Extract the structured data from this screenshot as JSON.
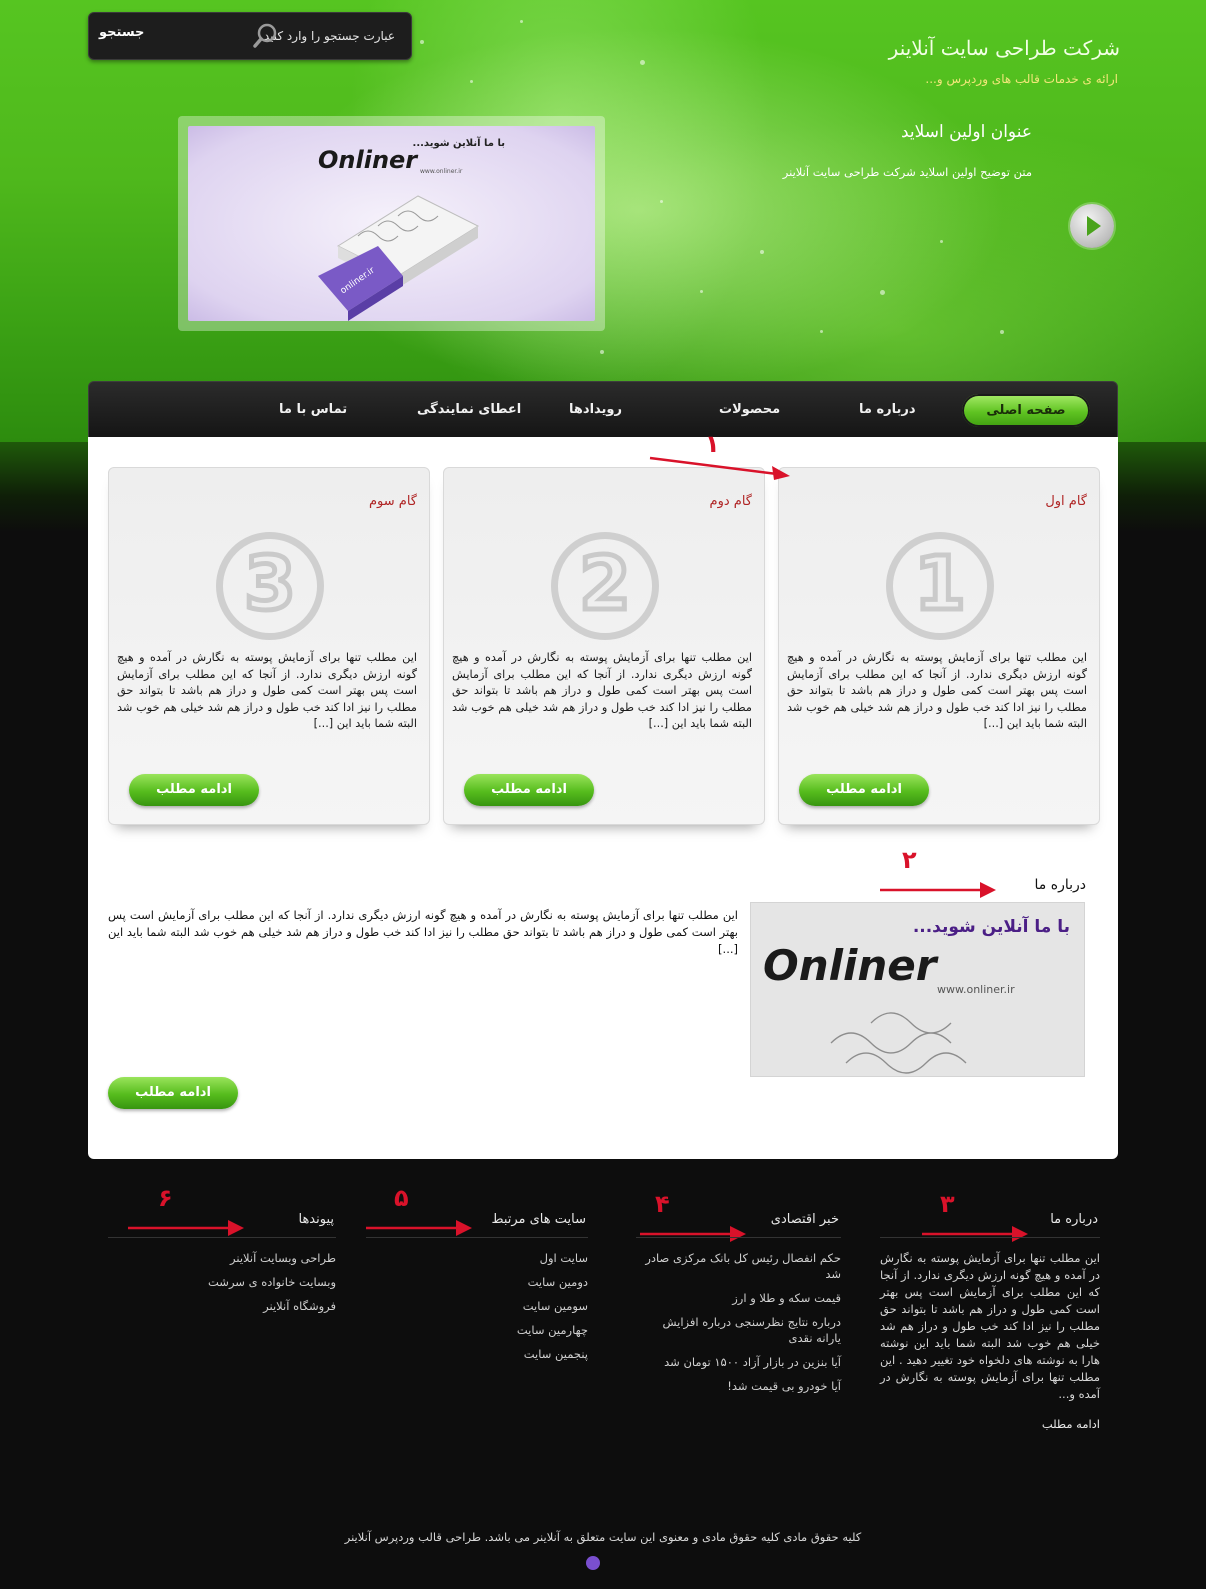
{
  "header": {
    "site_title": "شرکت طراحی سایت آنلاینر",
    "site_subtitle": "ارائه ی خدمات قالب های وردپرس و...",
    "search": {
      "placeholder": "عبارت جستجو را وارد کنید",
      "button_label": "جستجو"
    },
    "slider": {
      "title": "عنوان اولین اسلاید",
      "description": "متن توضیح اولین اسلاید شرکت طراحی سایت آنلاینر",
      "image_caption": "با ما آنلاین شوید...",
      "image_logo": "Onliner",
      "image_url": "www.onliner.ir",
      "image_piece_text": "onliner.ir"
    }
  },
  "nav": {
    "items": [
      {
        "label": "صفحه اصلی",
        "active": true
      },
      {
        "label": "درباره ما"
      },
      {
        "label": "محصولات"
      },
      {
        "label": "رویدادها"
      },
      {
        "label": "اعطای نمایندگی"
      },
      {
        "label": "تماس با ما"
      }
    ]
  },
  "steps": [
    {
      "title": "گام اول",
      "number": "1",
      "text": "این مطلب تنها برای آزمایش پوسته به نگارش در آمده و هیچ گونه ارزش دیگری ندارد. از آنجا که این مطلب برای آزمایش است پس بهتر است کمی طول و دراز هم باشد تا بتواند حق مطلب را نیز ادا کند خب طول و دراز هم شد خیلی هم خوب شد البته شما باید این [...]",
      "button": "ادامه مطلب"
    },
    {
      "title": "گام دوم",
      "number": "2",
      "text": "این مطلب تنها برای آزمایش پوسته به نگارش در آمده و هیچ گونه ارزش دیگری ندارد. از آنجا که این مطلب برای آزمایش است پس بهتر است کمی طول و دراز هم باشد تا بتواند حق مطلب را نیز ادا کند خب طول و دراز هم شد خیلی هم خوب شد البته شما باید این [...]",
      "button": "ادامه مطلب"
    },
    {
      "title": "گام سوم",
      "number": "3",
      "text": "این مطلب تنها برای آزمایش پوسته به نگارش در آمده و هیچ گونه ارزش دیگری ندارد. از آنجا که این مطلب برای آزمایش است پس بهتر است کمی طول و دراز هم باشد تا بتواند حق مطلب را نیز ادا کند خب طول و دراز هم شد خیلی هم خوب شد البته شما باید این [...]",
      "button": "ادامه مطلب"
    }
  ],
  "about": {
    "title": "درباره ما",
    "text": "این مطلب تنها برای آزمایش پوسته به نگارش در آمده و هیچ گونه ارزش دیگری ندارد. از آنجا که این مطلب برای آزمایش است پس بهتر است کمی طول و دراز هم باشد تا بتواند حق مطلب را نیز ادا کند خب طول و دراز هم شد خیلی هم خوب شد البته شما باید این [...]",
    "button": "ادامه مطلب",
    "image_caption": "با ما آنلاین شوید...",
    "image_logo": "Onliner",
    "image_url": "www.onliner.ir"
  },
  "annotations": [
    "۱",
    "۲",
    "۳",
    "۴",
    "۵",
    "۶"
  ],
  "footer": {
    "about": {
      "title": "درباره ما",
      "text": "این مطلب تنها برای آزمایش پوسته به نگارش در آمده و هیچ گونه ارزش دیگری ندارد. از آنجا که این مطلب برای آزمایش است پس بهتر است کمی طول و دراز هم باشد تا بتواند حق مطلب را نیز ادا کند خب طول و دراز هم شد خیلی هم خوب شد البته شما باید این نوشته هارا به نوشته های دلخواه خود تغییر دهید . این مطلب تنها برای آزمایش پوسته به نگارش در آمده و...",
      "more": "ادامه مطلب"
    },
    "news": {
      "title": "خبر اقتصادی",
      "items": [
        "حکم انفصال رئیس کل بانک مرکزی صادر شد",
        "قیمت سکه و طلا و ارز",
        "درباره نتایج نظرسنجی درباره افزایش یارانه نقدی",
        "آیا بنزین در بازار آزاد ۱۵۰۰ تومان شد",
        "آیا خودرو بی قیمت شد!"
      ]
    },
    "related": {
      "title": "سایت های مرتبط",
      "items": [
        "سایت اول",
        "دومین سایت",
        "سومین سایت",
        "چهارمین سایت",
        "پنجمین سایت"
      ]
    },
    "links": {
      "title": "پیوندها",
      "items": [
        "طراحی وبسایت آنلاینر",
        "وبسایت خانواده ی سرشت",
        "فروشگاه آنلاینر"
      ]
    },
    "copyright": "کلیه حقوق مادی کلیه حقوق مادی و معنوی این سایت متعلق به آنلاینر می باشد. طراحی قالب وردپرس آنلاینر"
  },
  "colors": {
    "header_green": "#4fb81c",
    "button_green": "#56bc1d",
    "step_title_red": "#b02525",
    "annotation_red": "#d9122a",
    "footer_bg": "#0d0d0d"
  }
}
